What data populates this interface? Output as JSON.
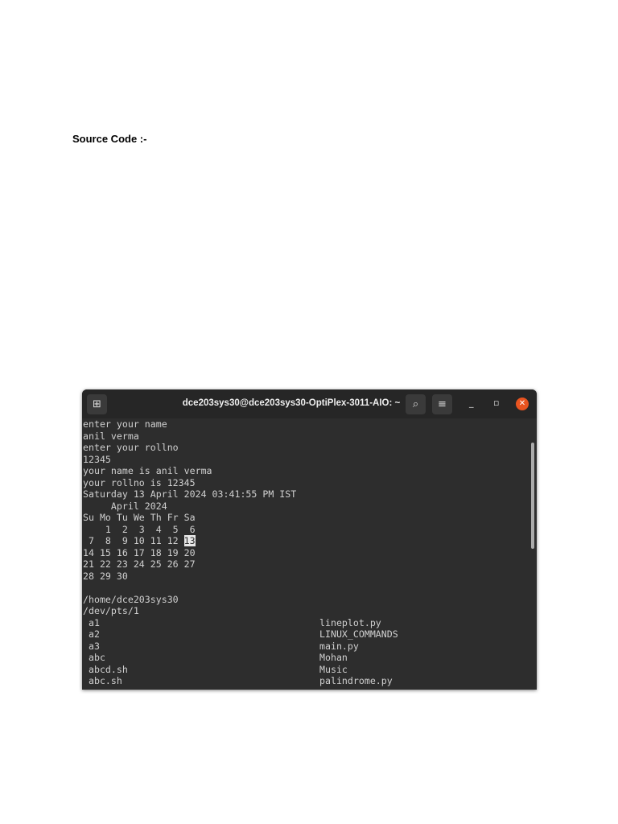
{
  "document": {
    "heading": "Source Code :-"
  },
  "terminal": {
    "title": "dce203sys30@dce203sys30-OptiPlex-3011-AIO: ~",
    "lines": [
      "enter your name",
      "anil verma",
      "enter your rollno",
      "12345",
      "your name is anil verma",
      "your rollno is 12345",
      "Saturday 13 April 2024 03:41:55 PM IST"
    ],
    "calendar": {
      "header": "     April 2024",
      "days": "Su Mo Tu We Th Fr Sa",
      "week1": "    1  2  3  4  5  6",
      "week2_pre": " 7  8  9 10 11 12 ",
      "today": "13",
      "week3": "14 15 16 17 18 19 20",
      "week4": "21 22 23 24 25 26 27",
      "week5": "28 29 30"
    },
    "pwd": "/home/dce203sys30",
    "tty": "/dev/pts/1",
    "files_left": [
      "a1",
      "a2",
      "a3",
      "abc",
      "abcd.sh",
      "abc.sh"
    ],
    "files_right": [
      "lineplot.py",
      "LINUX_COMMANDS",
      "main.py",
      "Mohan",
      "Music",
      "palindrome.py"
    ]
  }
}
